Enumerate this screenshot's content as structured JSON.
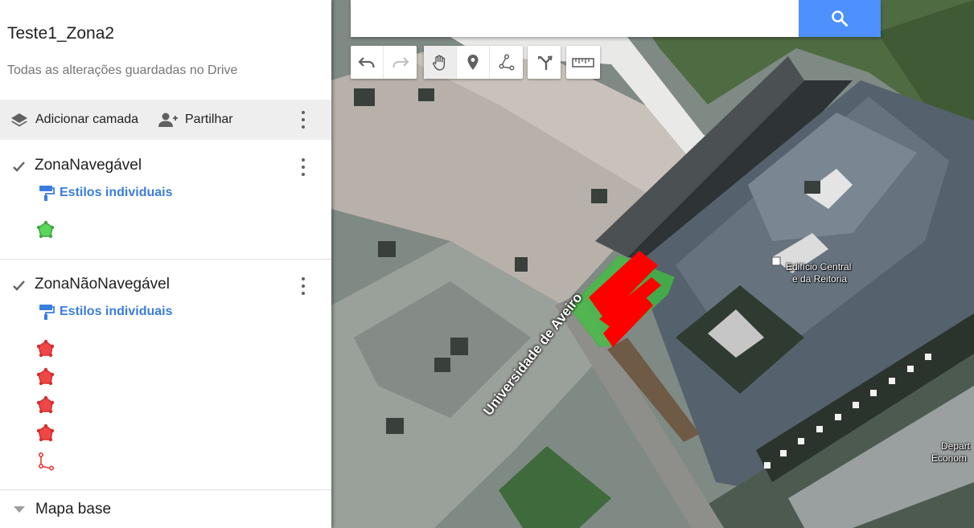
{
  "map": {
    "title": "Teste1_Zona2",
    "status": "Todas as alterações guardadas no Drive"
  },
  "actions": {
    "add_layer": "Adicionar camada",
    "share": "Partilhar"
  },
  "layers": [
    {
      "name": "ZonaNavegável",
      "checked": true,
      "styles_link": "Estilos individuais",
      "features": [
        {
          "type": "polygon",
          "color": "#5bd65b"
        }
      ]
    },
    {
      "name": "ZonaNãoNavegável",
      "checked": true,
      "styles_link": "Estilos individuais",
      "features": [
        {
          "type": "polygon",
          "color": "#ef4747"
        },
        {
          "type": "polygon",
          "color": "#ef4747"
        },
        {
          "type": "polygon",
          "color": "#ef4747"
        },
        {
          "type": "polygon",
          "color": "#ef4747"
        },
        {
          "type": "line",
          "color": "#e53935"
        }
      ]
    }
  ],
  "basemap": {
    "label": "Mapa base"
  },
  "search": {
    "placeholder": ""
  },
  "toolbar": {
    "tools": [
      "undo-icon",
      "redo-icon",
      "hand-pan-icon",
      "marker-icon",
      "draw-line-icon",
      "directions-icon",
      "ruler-icon"
    ],
    "active_tool": "hand-pan-icon"
  },
  "map_labels": {
    "building": [
      "Edifício Central",
      "e da Reitoria"
    ],
    "road": "Universidade de Aveiro",
    "dept": [
      "Depart",
      "Econom"
    ]
  },
  "colors": {
    "accent_blue": "#4d90fe",
    "link_blue": "#3b7ddd",
    "navigable_green": "#4caf50",
    "non_navigable_red": "#ff0000"
  }
}
